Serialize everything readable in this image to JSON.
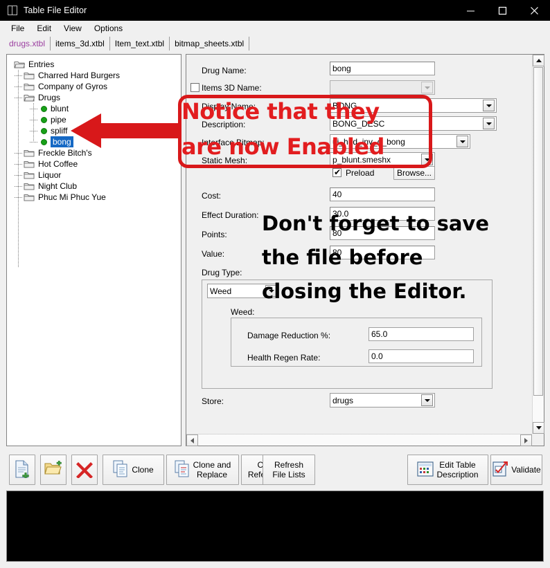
{
  "window": {
    "title": "Table File Editor",
    "icon": "window-icon",
    "minimize": "—",
    "maximize": "□",
    "close": "✕"
  },
  "menu": {
    "items": [
      "File",
      "Edit",
      "View",
      "Options"
    ]
  },
  "tabs": [
    {
      "label": "drugs.xtbl",
      "active": true
    },
    {
      "label": "items_3d.xtbl",
      "active": false
    },
    {
      "label": "Item_text.xtbl",
      "active": false
    },
    {
      "label": "bitmap_sheets.xtbl",
      "active": false
    }
  ],
  "tree": {
    "root": "Entries",
    "items": [
      {
        "label": "Charred Hard Burgers",
        "type": "folder",
        "depth": 1
      },
      {
        "label": "Company of Gyros",
        "type": "folder",
        "depth": 1
      },
      {
        "label": "Drugs",
        "type": "folder-open",
        "depth": 1
      },
      {
        "label": "blunt",
        "type": "leaf",
        "depth": 2
      },
      {
        "label": "pipe",
        "type": "leaf",
        "depth": 2
      },
      {
        "label": "spliff",
        "type": "leaf",
        "depth": 2
      },
      {
        "label": "bong",
        "type": "leaf",
        "depth": 2,
        "selected": true
      },
      {
        "label": "Freckle Bitch's",
        "type": "folder",
        "depth": 1
      },
      {
        "label": "Hot Coffee",
        "type": "folder",
        "depth": 1
      },
      {
        "label": "Liquor",
        "type": "folder",
        "depth": 1
      },
      {
        "label": "Night Club",
        "type": "folder",
        "depth": 1
      },
      {
        "label": "Phuc Mi Phuc Yue",
        "type": "folder",
        "depth": 1
      }
    ]
  },
  "form": {
    "drug_name": {
      "label": "Drug Name:",
      "value": "bong"
    },
    "items_3d_name": {
      "label": "Items 3D Name:",
      "value": "",
      "checked": false,
      "disabled": true
    },
    "display_name": {
      "label": "Display Name:",
      "value": "BONG"
    },
    "description": {
      "label": "Description:",
      "value": "BONG_DESC"
    },
    "interface_bitmap": {
      "label": "Interface Bitmap:",
      "value": "ui_hud_inv_d_bong"
    },
    "static_mesh": {
      "label": "Static Mesh:",
      "value": "p_blunt.smeshx"
    },
    "preload": {
      "label": "Preload",
      "checked": true
    },
    "browse": {
      "label": "Browse..."
    },
    "cost": {
      "label": "Cost:",
      "value": "40"
    },
    "effect_duration": {
      "label": "Effect Duration:",
      "value": "30.0"
    },
    "points": {
      "label": "Points:",
      "value": "80"
    },
    "value": {
      "label": "Value:",
      "value": "80"
    },
    "drug_type": {
      "label": "Drug Type:",
      "value": "Weed"
    },
    "weed_group": {
      "label": "Weed:"
    },
    "damage_reduction": {
      "label": "Damage Reduction %:",
      "value": "65.0"
    },
    "health_regen": {
      "label": "Health Regen Rate:",
      "value": "0.0"
    },
    "store": {
      "label": "Store:",
      "value": "drugs"
    }
  },
  "toolbar": {
    "new": {
      "label": "",
      "icon": "new-file-icon"
    },
    "open": {
      "label": "",
      "icon": "open-folder-icon"
    },
    "delete": {
      "label": "",
      "icon": "delete-x-icon"
    },
    "clone": {
      "label": "Clone",
      "icon": "clone-icon"
    },
    "clone_replace": {
      "label": "Clone and\nReplace",
      "icon": "clone-replace-icon"
    },
    "check_references": {
      "label": "Check\nReferences"
    },
    "refresh_file_lists": {
      "label": "Refresh\nFile Lists"
    },
    "edit_table_description": {
      "label": "Edit Table\nDescription",
      "icon": "table-icon"
    },
    "validate": {
      "label": "Validate",
      "icon": "validate-check-icon"
    }
  },
  "annotations": {
    "notice_line1": "Notice that they",
    "notice_line2": "are now Enabled",
    "save_line1": "Don't forget to save",
    "save_line2": "the file before",
    "save_line3": "closing the Editor."
  },
  "colors": {
    "annotation_red": "#e21d1f",
    "active_tab": "#9b3fa0",
    "selection_blue": "#1669c4",
    "leaf_dot_green": "#18a018"
  }
}
